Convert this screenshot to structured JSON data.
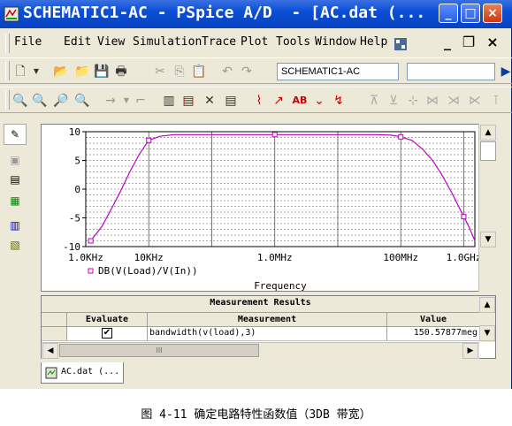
{
  "window": {
    "title": "SCHEMATIC1-AC - PSpice A/D  - [AC.dat (...",
    "buttons": {
      "minimize": "_",
      "maximize": "□",
      "close": "×"
    }
  },
  "menubar": {
    "items": [
      "File",
      "Edit",
      "View",
      "Simulation",
      "Trace",
      "Plot",
      "Tools",
      "Window",
      "Help"
    ],
    "mdi": {
      "minimize": "_",
      "restore": "❐",
      "close": "×"
    }
  },
  "toolbar1": {
    "profile_combo": "SCHEMATIC1-AC",
    "second_combo": ""
  },
  "chart_data": {
    "type": "line",
    "xscale": "log",
    "x_tick_labels": [
      "1.0KHz",
      "10KHz",
      "1.0MHz",
      "100MHz",
      "1.0GHz"
    ],
    "y_tick_labels": [
      "10",
      "5",
      "0",
      "-5",
      "-10"
    ],
    "ylim": [
      -10,
      10
    ],
    "xlabel": "Frequency",
    "legend": [
      "DB(V(Load)/V(In))"
    ],
    "series": [
      {
        "name": "DB(V(Load)/V(In))",
        "color": "#c000c0",
        "x": [
          1200,
          1800,
          2500,
          3500,
          5000,
          7000,
          10000,
          15000,
          25000,
          50000,
          100000,
          1000000,
          10000000,
          40000000,
          70000000,
          100000000,
          150000000,
          220000000,
          320000000,
          450000000,
          650000000,
          900000000,
          1200000000,
          1500000000
        ],
        "y": [
          -9.0,
          -6.5,
          -3.6,
          -0.5,
          3.0,
          6.0,
          8.5,
          9.2,
          9.5,
          9.5,
          9.5,
          9.5,
          9.5,
          9.5,
          9.4,
          9.1,
          8.5,
          7.0,
          5.0,
          2.5,
          -0.7,
          -3.8,
          -6.5,
          -9.0
        ]
      }
    ],
    "markers_x": [
      1200,
      10000,
      1000000,
      100000000,
      1000000000
    ]
  },
  "measurements": {
    "title": "Measurement Results",
    "headers": [
      "Evaluate",
      "Measurement",
      "Value"
    ],
    "rows": [
      {
        "checked": true,
        "measurement": "bandwidth(v(load),3)",
        "value": "150.57877meg"
      }
    ]
  },
  "hscroll_thumb": "III",
  "tab": {
    "label": "AC.dat (..."
  },
  "caption": "图 4-11 确定电路特性函数值（3DB 带宽）"
}
